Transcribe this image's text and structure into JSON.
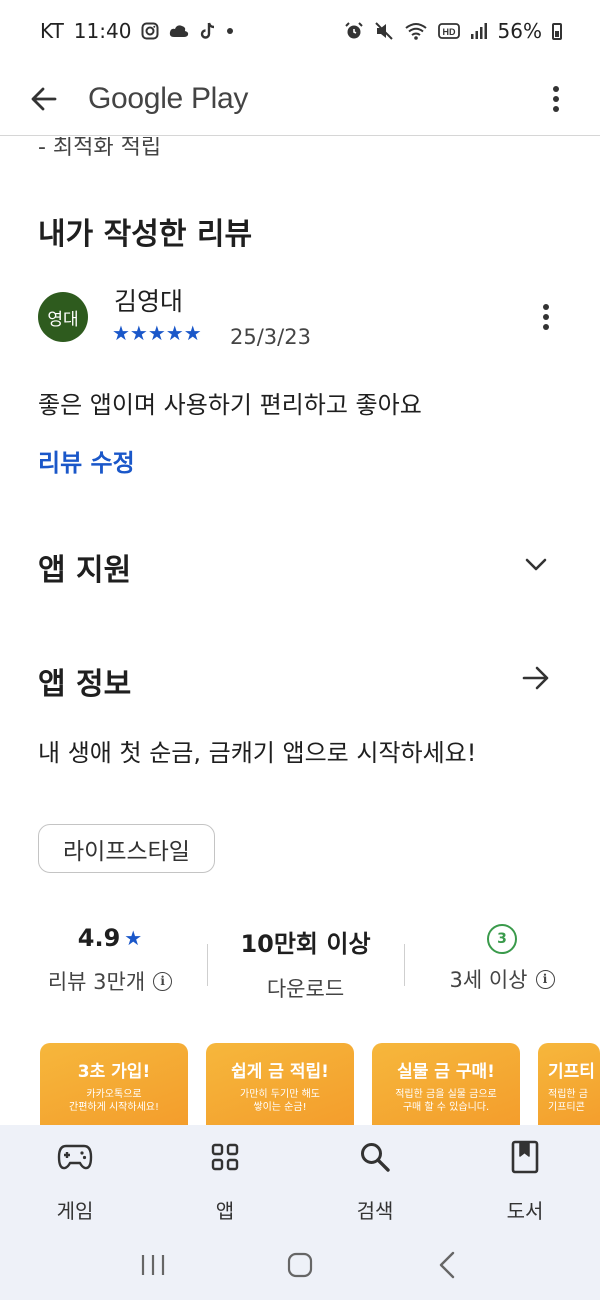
{
  "status_bar": {
    "carrier": "KT",
    "time": "11:40",
    "battery": "56%"
  },
  "app_bar": {
    "title": "Google Play"
  },
  "cut_text": "- 최적화 적립",
  "my_review": {
    "section_title": "내가 작성한 리뷰",
    "avatar_text": "영대",
    "reviewer_name": "김영대",
    "rating": 5,
    "stars": "★★★★★",
    "date": "25/3/23",
    "text": "좋은 앱이며 사용하기 편리하고 좋아요",
    "edit_label": "리뷰 수정"
  },
  "app_support": {
    "title": "앱 지원"
  },
  "app_info": {
    "title": "앱 정보",
    "description": "내 생애 첫 순금, 금캐기 앱으로 시작하세요!",
    "category": "라이프스타일"
  },
  "stats": {
    "rating_value": "4.9",
    "rating_label": "리뷰 3만개",
    "downloads_value": "10만회 이상",
    "downloads_label": "다운로드",
    "age_badge": "3",
    "age_label": "3세 이상"
  },
  "screenshots": [
    {
      "title": "3초 가입!",
      "sub": "카카오톡으로\n간편하게 시작하세요!"
    },
    {
      "title": "쉽게 금 적립!",
      "sub": "가만히 두기만 해도\n쌓이는 순금!"
    },
    {
      "title": "실물 금 구매!",
      "sub": "적립한 금을 실물 금으로\n구매 할 수 있습니다."
    },
    {
      "title": "기프티",
      "sub": "적립한 금\n기프티콘"
    }
  ],
  "bottom_nav": [
    {
      "label": "게임",
      "icon": "gamepad-icon"
    },
    {
      "label": "앱",
      "icon": "apps-grid-icon"
    },
    {
      "label": "검색",
      "icon": "search-icon"
    },
    {
      "label": "도서",
      "icon": "book-icon"
    }
  ],
  "colors": {
    "accent_blue": "#1a57c9",
    "avatar_green": "#2e5b1e",
    "age_green": "#3a9a4b",
    "screenshot_orange": "#f39a2a",
    "nav_bg": "#eef1f8"
  }
}
